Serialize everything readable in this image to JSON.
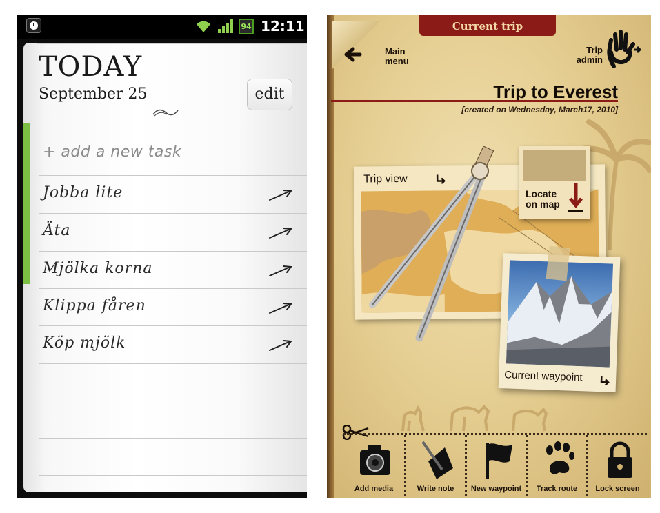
{
  "left_app": {
    "status_bar": {
      "battery_level": "94",
      "time": "12:11"
    },
    "header": {
      "title": "TODAY",
      "date": "September 25",
      "edit_label": "edit"
    },
    "add_task_placeholder": "+ add a new task",
    "tasks": [
      {
        "label": "Jobba lite"
      },
      {
        "label": "Äta"
      },
      {
        "label": "Mjölka korna"
      },
      {
        "label": "Klippa fåren"
      },
      {
        "label": "Köp mjölk"
      }
    ],
    "accent_color": "#7bc043"
  },
  "right_app": {
    "tab_label": "Current trip",
    "main_menu_label": "Main menu",
    "trip_admin_label": "Trip admin",
    "trip_title": "Trip to Everest",
    "created_text": "[created on Wednesday, March17, 2010]",
    "trip_view_label": "Trip view",
    "locate_label": "Locate on map",
    "current_waypoint_label": "Current waypoint",
    "toolbar": [
      {
        "label": "Add media",
        "icon": "camera-icon"
      },
      {
        "label": "Write note",
        "icon": "note-pen-icon"
      },
      {
        "label": "New waypoint",
        "icon": "flag-icon"
      },
      {
        "label": "Track route",
        "icon": "paw-print-icon"
      },
      {
        "label": "Lock screen",
        "icon": "padlock-icon"
      }
    ],
    "colors": {
      "tab_red": "#8a1b16",
      "paper": "#e6cf93"
    }
  }
}
